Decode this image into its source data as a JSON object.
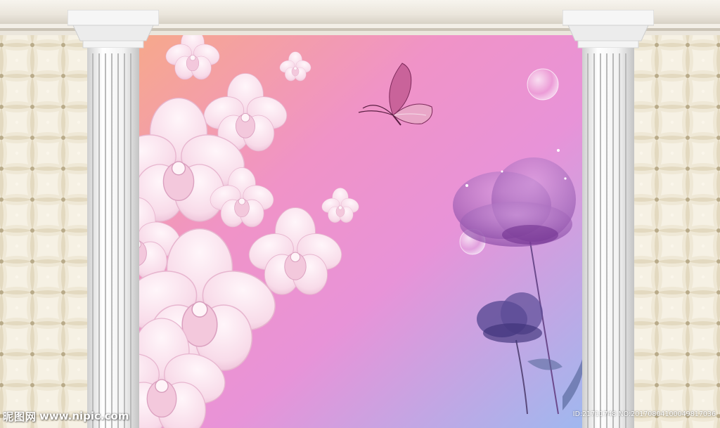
{
  "image": {
    "subject": "Wall mural: pink and purple flowers with a butterfly between two white classical columns on a quilted leather wall",
    "palette": {
      "mural_top_left": "#f7a98a",
      "mural_pink": "#ee8fd0",
      "mural_bottom_right": "#9fb3ee",
      "column": "#f4f4f4",
      "quilted_wall": "#e8dfc8",
      "petal": "#fbe3ef",
      "purple_flower": "#a05fb0"
    },
    "icons": [
      "butterfly-icon",
      "bubble-icon"
    ]
  },
  "watermark": {
    "logo": "昵图网",
    "site": "www.nipic.com",
    "id_text": "ID:21711748 NO:20170804100049817036"
  }
}
